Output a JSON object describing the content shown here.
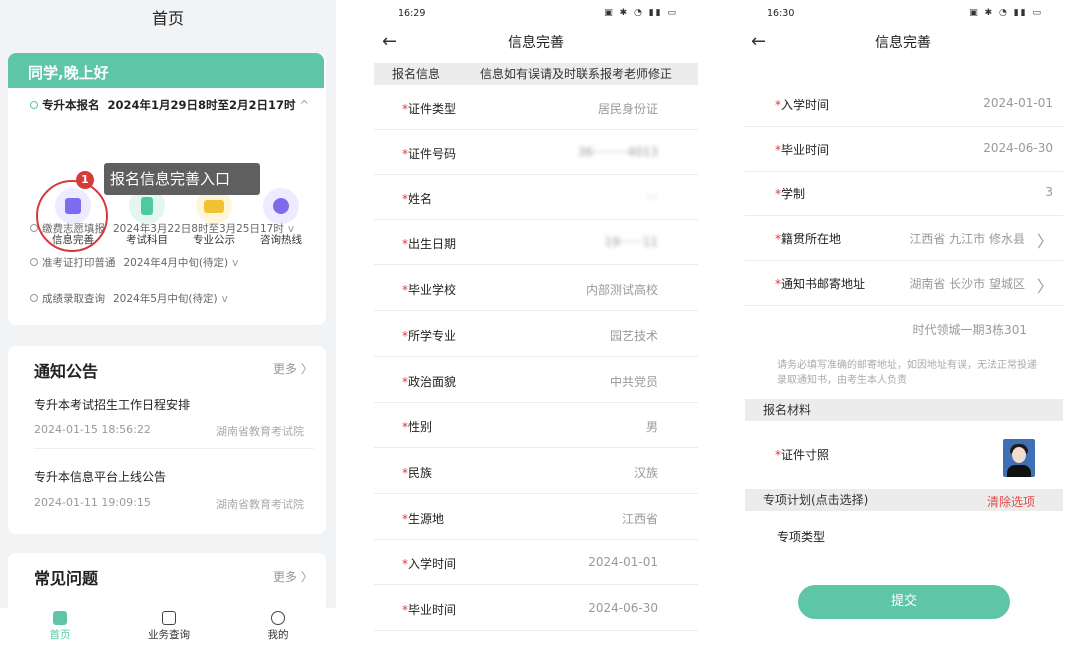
{
  "home": {
    "title": "首页",
    "greeting": "同学,晚上好",
    "timeline": [
      {
        "label": "专升本报名",
        "date": "2024年1月29日8时至2月2日17时",
        "chevron": "^"
      },
      {
        "label": "缴费志愿填报",
        "date": "2024年3月22日8时至3月25日17时",
        "chevron": "v"
      },
      {
        "label": "准考证打印普通",
        "date": "2024年4月中旬(待定)",
        "chevron": "v"
      },
      {
        "label": "成绩录取查询",
        "date": "2024年5月中旬(待定)",
        "chevron": "v"
      }
    ],
    "quick_actions": [
      {
        "label": "信息完善",
        "icon": "form-edit-icon",
        "color": "#7b6cf0",
        "bg": "#ecebff"
      },
      {
        "label": "考试科目",
        "icon": "phone-book-icon",
        "color": "#4fc99f",
        "bg": "#e3f7ef"
      },
      {
        "label": "专业公示",
        "icon": "envelope-icon",
        "color": "#f2c234",
        "bg": "#fff6da"
      },
      {
        "label": "咨询热线",
        "icon": "phone-icon",
        "color": "#7f6be8",
        "bg": "#ecebff"
      }
    ],
    "callout": {
      "number": "1",
      "text": "报名信息完善入口"
    },
    "notices": {
      "title": "通知公告",
      "more": "更多",
      "items": [
        {
          "title": "专升本考试招生工作日程安排",
          "date": "2024-01-15 18:56:22",
          "source": "湖南省教育考试院"
        },
        {
          "title": "专升本信息平台上线公告",
          "date": "2024-01-11 19:09:15",
          "source": "湖南省教育考试院"
        }
      ]
    },
    "faq": {
      "title": "常见问题",
      "more": "更多"
    },
    "tabs": [
      {
        "label": "首页",
        "icon": "home-icon",
        "active": true
      },
      {
        "label": "业务查询",
        "icon": "search-doc-icon",
        "active": false
      },
      {
        "label": "我的",
        "icon": "user-icon",
        "active": false
      }
    ]
  },
  "form1": {
    "status_time": "16:29",
    "title": "信息完善",
    "section_label": "报名信息",
    "section_hint": "信息如有误请及时联系报考老师修正",
    "fields": [
      {
        "label": "证件类型",
        "value": "居民身份证"
      },
      {
        "label": "证件号码",
        "value": "36·········4013"
      },
      {
        "label": "姓名",
        "value": "···"
      },
      {
        "label": "出生日期",
        "value": "19······11"
      },
      {
        "label": "毕业学校",
        "value": "内部测试高校"
      },
      {
        "label": "所学专业",
        "value": "园艺技术"
      },
      {
        "label": "政治面貌",
        "value": "中共党员"
      },
      {
        "label": "性别",
        "value": "男"
      },
      {
        "label": "民族",
        "value": "汉族"
      },
      {
        "label": "生源地",
        "value": "江西省"
      },
      {
        "label": "入学时间",
        "value": "2024-01-01"
      },
      {
        "label": "毕业时间",
        "value": "2024-06-30"
      }
    ]
  },
  "form2": {
    "status_time": "16:30",
    "title": "信息完善",
    "fields": [
      {
        "label": "入学时间",
        "value": "2024-01-01"
      },
      {
        "label": "毕业时间",
        "value": "2024-06-30"
      },
      {
        "label": "学制",
        "value": "3"
      },
      {
        "label": "籍贯所在地",
        "value": "江西省  九江市  修水县"
      },
      {
        "label": "通知书邮寄地址",
        "value": "湖南省  长沙市  望城区"
      }
    ],
    "address_detail": "时代领城一期3栋301",
    "address_note": "请务必填写准确的邮寄地址，如因地址有误，无法正常投递录取通知书，由考生本人负责",
    "materials_title": "报名材料",
    "photo_label": "证件寸照",
    "special_title": "专项计划(点击选择)",
    "clear_label": "清除选项",
    "special_type_label": "专项类型",
    "submit_label": "提交"
  }
}
